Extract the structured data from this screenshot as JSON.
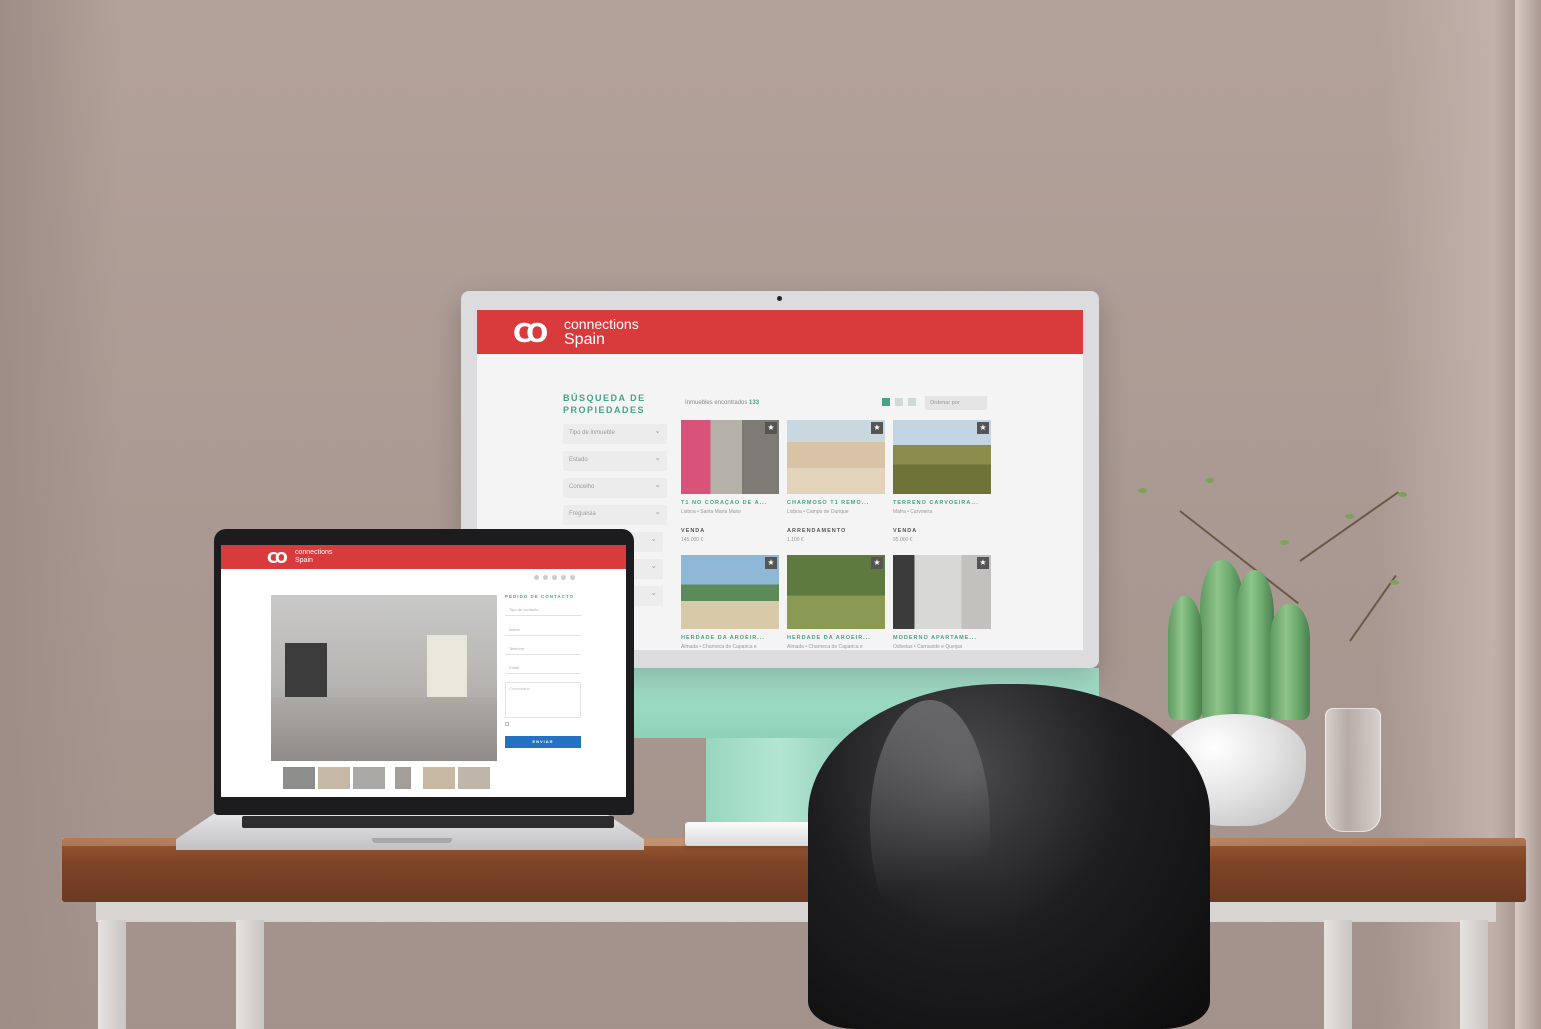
{
  "monitor_site": {
    "brand": {
      "mark": "CO",
      "line1": "connections",
      "line2": "Spain"
    },
    "sidebar": {
      "title_line1": "BÚSQUEDA DE",
      "title_line2": "PROPIEDADES",
      "filters": [
        "Tipo de inmueble",
        "Estado",
        "Concelho",
        "Freguesia"
      ]
    },
    "results": {
      "label": "Inmuebles encontrados",
      "count": "133"
    },
    "sort_label": "Ordenar por",
    "listings": [
      {
        "title": "T1 NO CORAÇÃO DE A...",
        "location": "Lisboa • Santa Maria Maior",
        "type": "VENDA",
        "price": "145.000 €"
      },
      {
        "title": "CHARMOSO T1 REMO...",
        "location": "Lisboa • Campo de Ourique",
        "type": "ARRENDAMENTO",
        "price": "1.100 €"
      },
      {
        "title": "TERRENO CARVOEIRA...",
        "location": "Mafra • Carvoeira",
        "type": "VENDA",
        "price": "95.000 €"
      },
      {
        "title": "HERDADE DA AROEIR...",
        "location": "Almada • Charneca de Caparica e",
        "type": "",
        "price": ""
      },
      {
        "title": "HERDADE DA AROEIR...",
        "location": "Almada • Charneca de Caparica e",
        "type": "",
        "price": ""
      },
      {
        "title": "MODERNO APARTAME...",
        "location": "Odivelas • Carnaxide e Queijas",
        "type": "",
        "price": ""
      }
    ]
  },
  "laptop_site": {
    "brand": {
      "mark": "CO",
      "line1": "connections",
      "line2": "Spain"
    },
    "form": {
      "title": "PEDIDO DE CONTACTO",
      "fields": [
        "Tipo de contacto",
        "Nome",
        "Telefone",
        "Email"
      ],
      "message_placeholder": "Comentário",
      "submit": "ENVIAR"
    }
  }
}
